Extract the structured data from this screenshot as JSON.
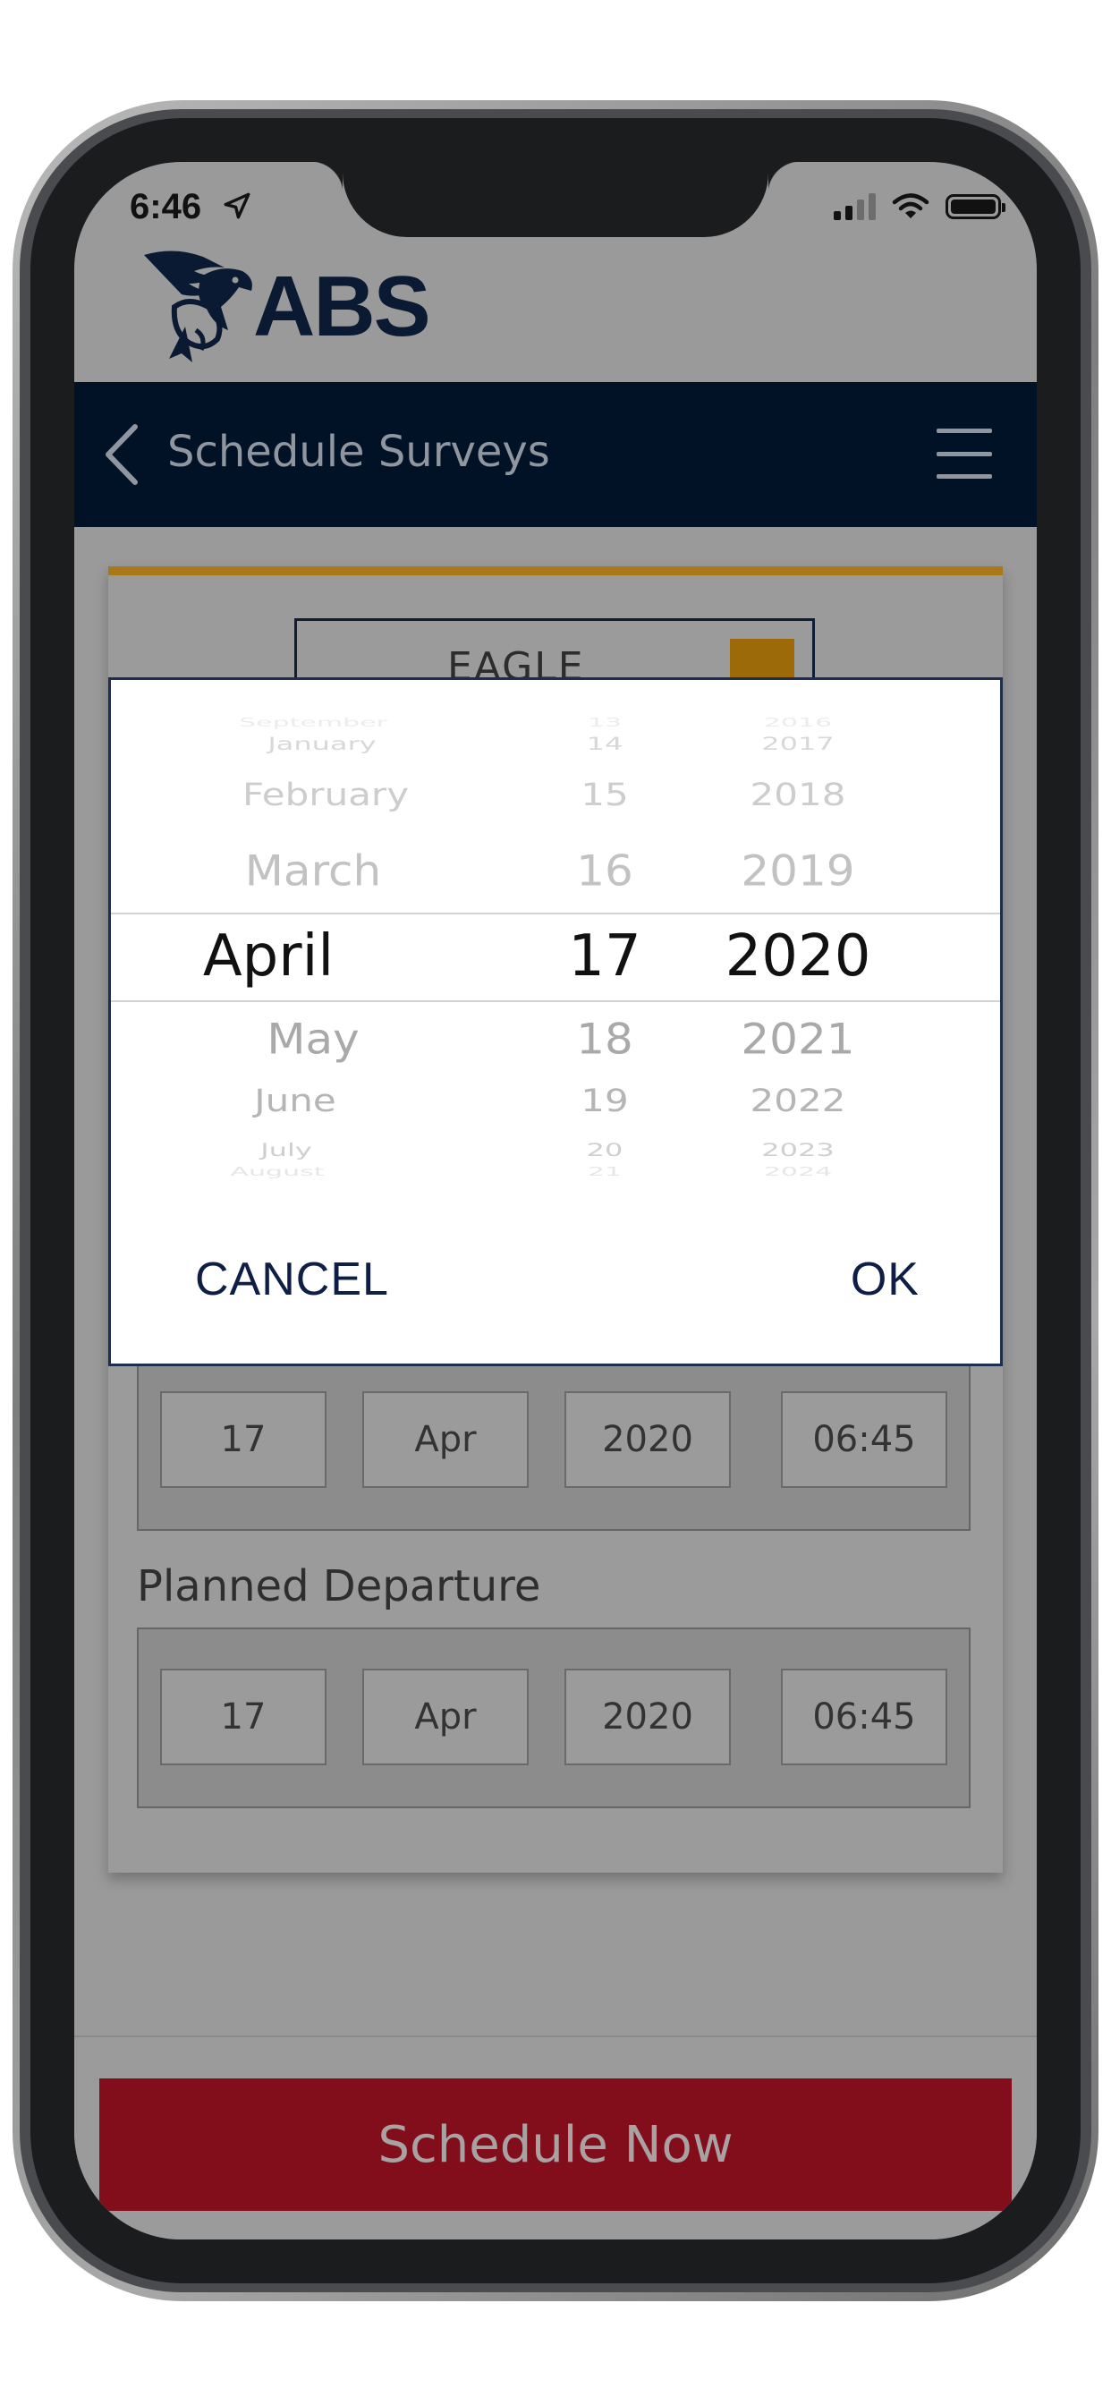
{
  "status": {
    "time": "6:46"
  },
  "brand": {
    "logo_text": "ABS"
  },
  "navbar": {
    "title": "Schedule Surveys"
  },
  "vessel": {
    "name": "EAGLE"
  },
  "arrival": {
    "day": "17",
    "month": "Apr",
    "year": "2020",
    "time": "06:45"
  },
  "departure": {
    "label": "Planned Departure",
    "day": "17",
    "month": "Apr",
    "year": "2020",
    "time": "06:45"
  },
  "schedule_button": "Schedule Now",
  "date_picker": {
    "months": [
      "September",
      "January",
      "February",
      "March",
      "April",
      "May",
      "June",
      "July",
      "August"
    ],
    "days": [
      "13",
      "14",
      "15",
      "16",
      "17",
      "18",
      "19",
      "20",
      "21"
    ],
    "years": [
      "2016",
      "2017",
      "2018",
      "2019",
      "2020",
      "2021",
      "2022",
      "2023",
      "2024"
    ],
    "selected": {
      "month": "April",
      "day": "17",
      "year": "2020"
    },
    "cancel_label": "CANCEL",
    "ok_label": "OK"
  },
  "colors": {
    "navbar": "#021226",
    "accent_gold": "#a8781a",
    "schedule_button": "#820e1c",
    "dialog_text": "#0e1e45"
  }
}
